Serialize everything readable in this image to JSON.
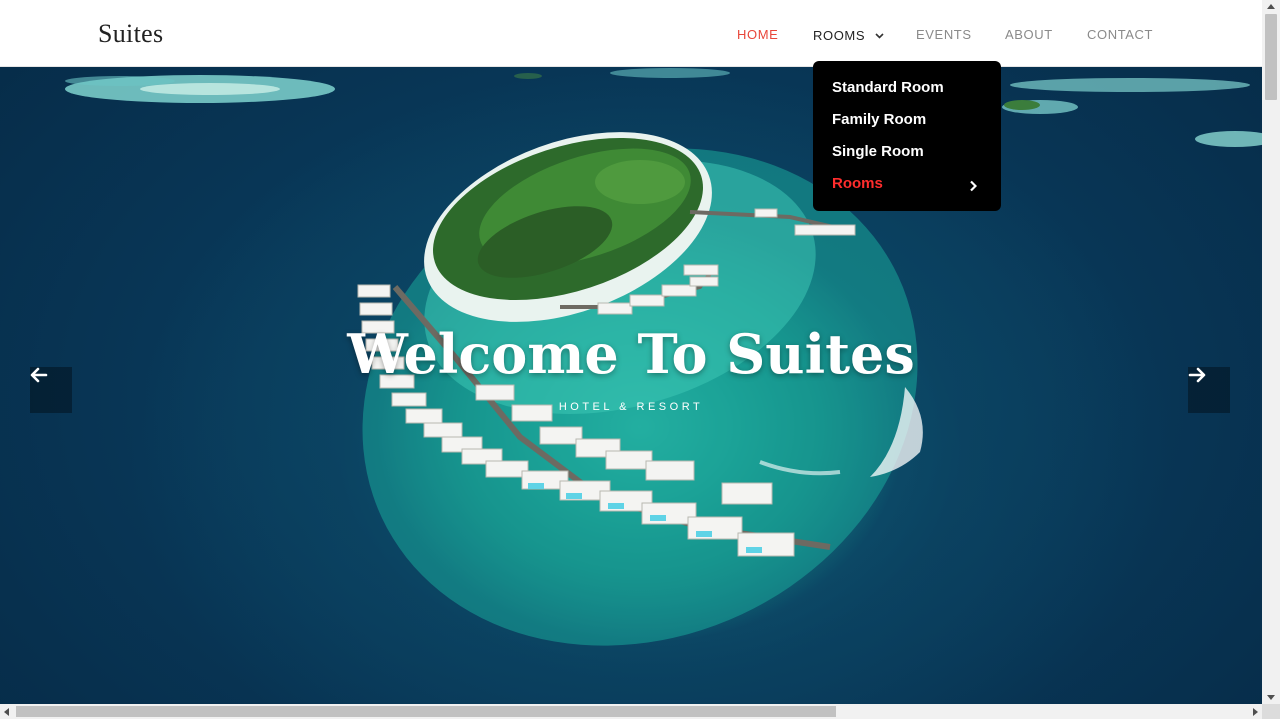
{
  "brand": {
    "logo_text": "Suites"
  },
  "nav": {
    "home": "HOME",
    "rooms": "ROOMS",
    "events": "EVENTS",
    "about": "ABOUT",
    "contact": "CONTACT",
    "active_color": "#e8463a"
  },
  "rooms_dropdown": {
    "items": [
      {
        "label": "Standard Room"
      },
      {
        "label": "Family Room"
      },
      {
        "label": "Single Room"
      },
      {
        "label": "Rooms",
        "has_submenu": true,
        "active": true
      }
    ],
    "background": "#000000",
    "active_color": "#ff2d2d"
  },
  "hero": {
    "title": "Welcome To Suites",
    "subtitle": "HOTEL & RESORT",
    "prev_icon": "arrow-left-icon",
    "next_icon": "arrow-right-icon"
  }
}
